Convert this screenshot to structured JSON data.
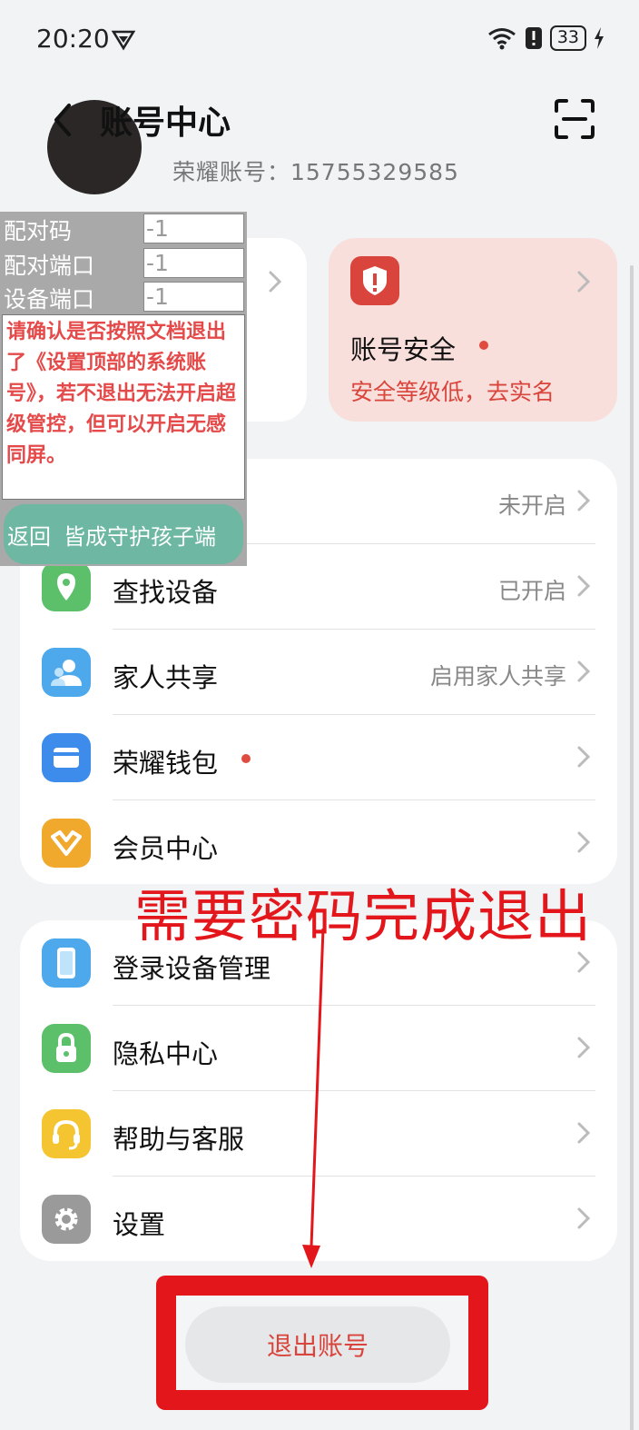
{
  "status_bar": {
    "time": "20:20",
    "battery": "33"
  },
  "header": {
    "title": "账号中心"
  },
  "profile": {
    "account_line": "荣耀账号：15755329585"
  },
  "security_card": {
    "title": "账号安全",
    "subtitle": "安全等级低，去实名"
  },
  "list_group_1": [
    {
      "label": "",
      "value": "未开启",
      "icon": "",
      "color": ""
    },
    {
      "label": "查找设备",
      "value": "已开启",
      "icon": "location-pin-icon",
      "color": "#5cc06a"
    },
    {
      "label": "家人共享",
      "value": "启用家人共享",
      "icon": "family-share-icon",
      "color": "#4ea9ec"
    },
    {
      "label": "荣耀钱包",
      "value": "",
      "icon": "wallet-icon",
      "color": "#3d8bea"
    },
    {
      "label": "会员中心",
      "value": "",
      "icon": "vip-icon",
      "color": "#f0a92c"
    }
  ],
  "list_group_2": [
    {
      "label": "登录设备管理",
      "icon": "device-icon",
      "color": "#4ea9ec"
    },
    {
      "label": "隐私中心",
      "icon": "lock-icon",
      "color": "#5cc06a"
    },
    {
      "label": "帮助与客服",
      "icon": "headset-icon",
      "color": "#f5c531"
    },
    {
      "label": "设置",
      "icon": "gear-icon",
      "color": "#9a9a9a"
    }
  ],
  "logout": {
    "label": "退出账号"
  },
  "overlay": {
    "pair_code_label": "配对码",
    "pair_code_value": "-1",
    "pair_port_label": "配对端口",
    "pair_port_value": "-1",
    "device_port_label": "设备端口",
    "device_port_value": "-1",
    "note": "请确认是否按照文档退出了《设置顶部的系统账号》，若不退出无法开启超级管控，但可以开启无感同屏。",
    "back_label": "返回",
    "guard_label": "皆成守护孩子端"
  },
  "annotation": {
    "text": "需要密码完成退出"
  },
  "colors": {
    "accent_red": "#e3161b",
    "security_red": "#d9453c",
    "overlay_green": "#6db7a3"
  }
}
